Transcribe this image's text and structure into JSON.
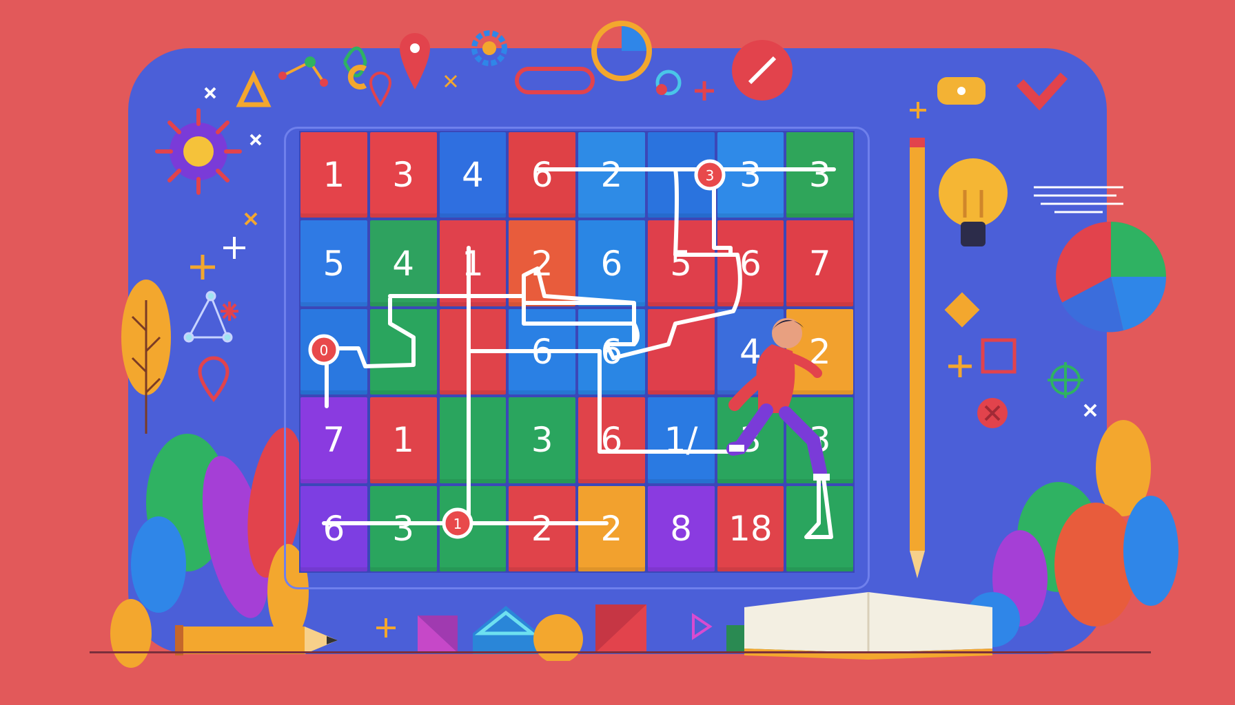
{
  "colors": {
    "background": "#e2595a",
    "panel": "#4b5fd8",
    "path": "#ffffff",
    "marker": "#e8494b"
  },
  "board": {
    "rows": [
      [
        {
          "value": "1",
          "color": "#e4434a"
        },
        {
          "value": "3",
          "color": "#e4434a"
        },
        {
          "value": "4",
          "color": "#2f6fe0"
        },
        {
          "value": "6",
          "color": "#df4146"
        },
        {
          "value": "2",
          "color": "#2e8be6"
        },
        {
          "value": "",
          "color": "#2a73de"
        },
        {
          "value": "3",
          "color": "#2f8ae8"
        },
        {
          "value": "3",
          "color": "#2fa55a"
        }
      ],
      [
        {
          "value": "5",
          "color": "#2f7ae4"
        },
        {
          "value": "4",
          "color": "#2ea25f"
        },
        {
          "value": "1",
          "color": "#e0414c"
        },
        {
          "value": "2",
          "color": "#e85c3c"
        },
        {
          "value": "6",
          "color": "#2a86e4"
        },
        {
          "value": "5",
          "color": "#df3f4b"
        },
        {
          "value": "6",
          "color": "#e03f4a"
        },
        {
          "value": "7",
          "color": "#df3f48"
        }
      ],
      [
        {
          "value": "",
          "color": "#2a78e0"
        },
        {
          "value": "",
          "color": "#2aa55e"
        },
        {
          "value": "",
          "color": "#e0434a"
        },
        {
          "value": "6",
          "color": "#2a80e4"
        },
        {
          "value": "6",
          "color": "#2a86e4"
        },
        {
          "value": "",
          "color": "#df3f4b"
        },
        {
          "value": "4",
          "color": "#3b6ddc"
        },
        {
          "value": "2",
          "color": "#f2a12e"
        }
      ],
      [
        {
          "value": "7",
          "color": "#8a3be0"
        },
        {
          "value": "1",
          "color": "#e0434a"
        },
        {
          "value": "",
          "color": "#2aa55e"
        },
        {
          "value": "3",
          "color": "#2aa55e"
        },
        {
          "value": "6",
          "color": "#e0434a"
        },
        {
          "value": "1/",
          "color": "#2a7ae2"
        },
        {
          "value": "3",
          "color": "#2aa55e"
        },
        {
          "value": "3",
          "color": "#2aa55e"
        }
      ],
      [
        {
          "value": "6",
          "color": "#7d3ee2"
        },
        {
          "value": "3",
          "color": "#2aa55e"
        },
        {
          "value": "",
          "color": "#2aa55e"
        },
        {
          "value": "2",
          "color": "#e0434a"
        },
        {
          "value": "2",
          "color": "#f2a12e"
        },
        {
          "value": "8",
          "color": "#8a3be0"
        },
        {
          "value": "18",
          "color": "#e0434a"
        },
        {
          "value": "",
          "color": "#2aa55e"
        }
      ]
    ],
    "markers": [
      "3",
      "0",
      "1"
    ]
  }
}
